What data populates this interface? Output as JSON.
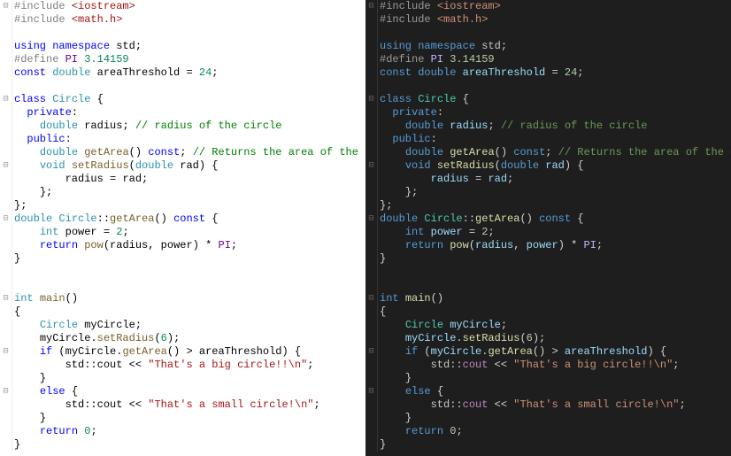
{
  "chart_data": null,
  "code": {
    "tokens_by_line": [
      [
        [
          "pre",
          "#include "
        ],
        [
          "str",
          "<iostream>"
        ]
      ],
      [
        [
          "pre",
          "#include "
        ],
        [
          "str",
          "<math.h>"
        ]
      ],
      [],
      [
        [
          "kw",
          "using"
        ],
        [
          "op",
          " "
        ],
        [
          "kw",
          "namespace"
        ],
        [
          "op",
          " "
        ],
        [
          "ns",
          "std"
        ],
        [
          "pun",
          ";"
        ]
      ],
      [
        [
          "pre",
          "#define "
        ],
        [
          "mac",
          "PI"
        ],
        [
          "op",
          " "
        ],
        [
          "num",
          "3.14159"
        ]
      ],
      [
        [
          "kw",
          "const"
        ],
        [
          "op",
          " "
        ],
        [
          "type",
          "double"
        ],
        [
          "op",
          " "
        ],
        [
          "var",
          "areaThreshold"
        ],
        [
          "op",
          " = "
        ],
        [
          "num",
          "24"
        ],
        [
          "pun",
          ";"
        ]
      ],
      [],
      [
        [
          "kw",
          "class"
        ],
        [
          "op",
          " "
        ],
        [
          "cls",
          "Circle"
        ],
        [
          "op",
          " "
        ],
        [
          "pun",
          "{"
        ]
      ],
      [
        [
          "op",
          "  "
        ],
        [
          "kw",
          "private"
        ],
        [
          "pun",
          ":"
        ]
      ],
      [
        [
          "op",
          "    "
        ],
        [
          "type",
          "double"
        ],
        [
          "op",
          " "
        ],
        [
          "var",
          "radius"
        ],
        [
          "pun",
          ";"
        ],
        [
          "op",
          " "
        ],
        [
          "cmt",
          "// radius of the circle"
        ]
      ],
      [
        [
          "op",
          "  "
        ],
        [
          "kw",
          "public"
        ],
        [
          "pun",
          ":"
        ]
      ],
      [
        [
          "op",
          "    "
        ],
        [
          "type",
          "double"
        ],
        [
          "op",
          " "
        ],
        [
          "func",
          "getArea"
        ],
        [
          "pun",
          "()"
        ],
        [
          "op",
          " "
        ],
        [
          "kw",
          "const"
        ],
        [
          "pun",
          ";"
        ],
        [
          "op",
          " "
        ],
        [
          "cmt",
          "// Returns the area of the circle"
        ]
      ],
      [
        [
          "op",
          "    "
        ],
        [
          "type",
          "void"
        ],
        [
          "op",
          " "
        ],
        [
          "func",
          "setRadius"
        ],
        [
          "pun",
          "("
        ],
        [
          "type",
          "double"
        ],
        [
          "op",
          " "
        ],
        [
          "var",
          "rad"
        ],
        [
          "pun",
          ")"
        ],
        [
          "op",
          " "
        ],
        [
          "pun",
          "{"
        ]
      ],
      [
        [
          "op",
          "        "
        ],
        [
          "var",
          "radius"
        ],
        [
          "op",
          " = "
        ],
        [
          "var",
          "rad"
        ],
        [
          "pun",
          ";"
        ]
      ],
      [
        [
          "op",
          "    "
        ],
        [
          "pun",
          "};"
        ]
      ],
      [
        [
          "pun",
          "};"
        ]
      ],
      [
        [
          "type",
          "double"
        ],
        [
          "op",
          " "
        ],
        [
          "cls",
          "Circle"
        ],
        [
          "pun",
          "::"
        ],
        [
          "func",
          "getArea"
        ],
        [
          "pun",
          "()"
        ],
        [
          "op",
          " "
        ],
        [
          "kw",
          "const"
        ],
        [
          "op",
          " "
        ],
        [
          "pun",
          "{"
        ]
      ],
      [
        [
          "op",
          "    "
        ],
        [
          "type",
          "int"
        ],
        [
          "op",
          " "
        ],
        [
          "var",
          "power"
        ],
        [
          "op",
          " = "
        ],
        [
          "num",
          "2"
        ],
        [
          "pun",
          ";"
        ]
      ],
      [
        [
          "op",
          "    "
        ],
        [
          "kw",
          "return"
        ],
        [
          "op",
          " "
        ],
        [
          "func",
          "pow"
        ],
        [
          "pun",
          "("
        ],
        [
          "var",
          "radius"
        ],
        [
          "pun",
          ", "
        ],
        [
          "var",
          "power"
        ],
        [
          "pun",
          ")"
        ],
        [
          "op",
          " * "
        ],
        [
          "mac",
          "PI"
        ],
        [
          "pun",
          ";"
        ]
      ],
      [
        [
          "pun",
          "}"
        ]
      ],
      [],
      [],
      [
        [
          "type",
          "int"
        ],
        [
          "op",
          " "
        ],
        [
          "func",
          "main"
        ],
        [
          "pun",
          "()"
        ]
      ],
      [
        [
          "pun",
          "{"
        ]
      ],
      [
        [
          "op",
          "    "
        ],
        [
          "cls",
          "Circle"
        ],
        [
          "op",
          " "
        ],
        [
          "var",
          "myCircle"
        ],
        [
          "pun",
          ";"
        ]
      ],
      [
        [
          "op",
          "    "
        ],
        [
          "var",
          "myCircle"
        ],
        [
          "pun",
          "."
        ],
        [
          "func",
          "setRadius"
        ],
        [
          "pun",
          "("
        ],
        [
          "num",
          "6"
        ],
        [
          "pun",
          ");"
        ]
      ],
      [
        [
          "op",
          "    "
        ],
        [
          "kw",
          "if"
        ],
        [
          "op",
          " "
        ],
        [
          "pun",
          "("
        ],
        [
          "var",
          "myCircle"
        ],
        [
          "pun",
          "."
        ],
        [
          "func",
          "getArea"
        ],
        [
          "pun",
          "()"
        ],
        [
          "op",
          " > "
        ],
        [
          "var",
          "areaThreshold"
        ],
        [
          "pun",
          ")"
        ],
        [
          "op",
          " "
        ],
        [
          "pun",
          "{"
        ]
      ],
      [
        [
          "op",
          "        "
        ],
        [
          "ns",
          "std"
        ],
        [
          "pun",
          "::"
        ],
        [
          "glob",
          "cout"
        ],
        [
          "op",
          " << "
        ],
        [
          "str",
          "\"That's a big circle!!\\n\""
        ],
        [
          "pun",
          ";"
        ]
      ],
      [
        [
          "op",
          "    "
        ],
        [
          "pun",
          "}"
        ]
      ],
      [
        [
          "op",
          "    "
        ],
        [
          "kw",
          "else"
        ],
        [
          "op",
          " "
        ],
        [
          "pun",
          "{"
        ]
      ],
      [
        [
          "op",
          "        "
        ],
        [
          "ns",
          "std"
        ],
        [
          "pun",
          "::"
        ],
        [
          "glob",
          "cout"
        ],
        [
          "op",
          " << "
        ],
        [
          "str",
          "\"That's a small circle!\\n\""
        ],
        [
          "pun",
          ";"
        ]
      ],
      [
        [
          "op",
          "    "
        ],
        [
          "pun",
          "}"
        ]
      ],
      [
        [
          "op",
          "    "
        ],
        [
          "kw",
          "return"
        ],
        [
          "op",
          " "
        ],
        [
          "num",
          "0"
        ],
        [
          "pun",
          ";"
        ]
      ],
      [
        [
          "pun",
          "}"
        ]
      ]
    ],
    "fold_gutter": [
      "-",
      "",
      "",
      "",
      "",
      "",
      "",
      "-",
      "",
      "",
      "",
      "",
      "-",
      "",
      "",
      "",
      "-",
      "",
      "",
      "",
      "",
      "",
      "-",
      "",
      "",
      "",
      "-",
      "",
      "",
      "-",
      "",
      "",
      "",
      ""
    ]
  },
  "panes": [
    {
      "theme": "light"
    },
    {
      "theme": "dark"
    }
  ]
}
